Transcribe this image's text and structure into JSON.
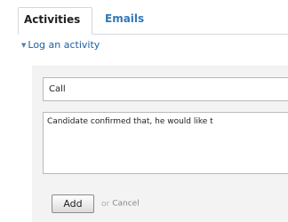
{
  "tabs": [
    {
      "label": "Activities",
      "active": true
    },
    {
      "label": "Emails",
      "active": false
    }
  ],
  "section": {
    "toggle_icon": "triangle-down-icon",
    "title": "Log an activity"
  },
  "form": {
    "activity_type": "Call",
    "notes": "Candidate confirmed that, he would like t",
    "add_label": "Add",
    "or_text": "or",
    "cancel_label": "Cancel"
  },
  "colors": {
    "link": "#1a5fa8",
    "tab_inactive": "#3277b8",
    "panel_bg": "#f3f3f3"
  }
}
